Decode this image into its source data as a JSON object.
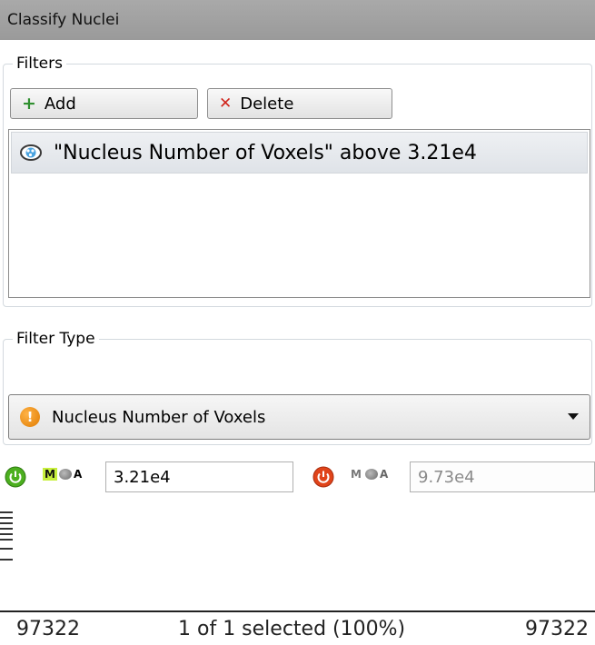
{
  "panel": {
    "title": "Classify Nuclei"
  },
  "filters": {
    "legend": "Filters",
    "add_label": "Add",
    "delete_label": "Delete",
    "items": [
      {
        "label": "\"Nucleus Number of Voxels\" above 3.21e4",
        "icon": "eye-icon"
      }
    ]
  },
  "filter_type": {
    "legend": "Filter Type",
    "selected": "Nucleus Number of Voxels",
    "icon": "warning-icon"
  },
  "range": {
    "lower_value": "3.21e4",
    "upper_value": "9.73e4",
    "mga_m": "M",
    "mga_a": "A"
  },
  "histogram": {
    "min_label": "97322",
    "selected_label": "1 of 1 selected (100%)",
    "max_label": "97322"
  },
  "colors": {
    "titlebar": "#a3a3a3",
    "add_icon": "#2f8f2f",
    "delete_icon": "#d0241b",
    "power_on": "#4caf1f",
    "power_off": "#e0441a"
  }
}
